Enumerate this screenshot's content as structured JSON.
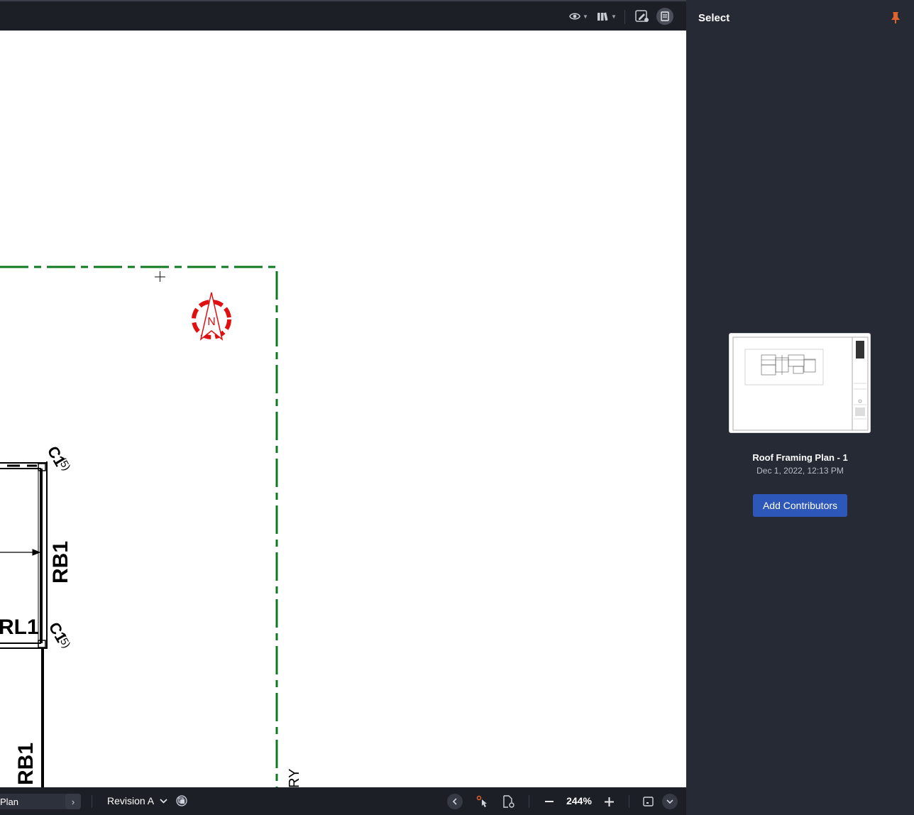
{
  "toolbar": {
    "icons": [
      "visibility-icon",
      "library-icon",
      "markup-icon",
      "sheet-info-icon"
    ]
  },
  "canvas": {
    "labels": {
      "c1_top": "C1",
      "s5_top": "(5)",
      "rb1_right": "RB1",
      "rl1": "RL1",
      "c1_bottom": "C1",
      "s5_bottom": "(5)",
      "rb1_bottom": "RB1",
      "ry": "RY",
      "north": "N"
    }
  },
  "panel": {
    "title": "Select",
    "document": {
      "name": "Roof Framing Plan - 1",
      "date": "Dec 1, 2022, 12:13 PM"
    },
    "add_contributors_label": "Add Contributors"
  },
  "bottombar": {
    "sheet_label": "Plan",
    "revision_label": "Revision A",
    "zoom": "244%"
  },
  "colors": {
    "accent": "#2d57b8",
    "pin": "#e0622c",
    "boundary": "#0d7a1f",
    "north_arrow": "#e01010"
  }
}
